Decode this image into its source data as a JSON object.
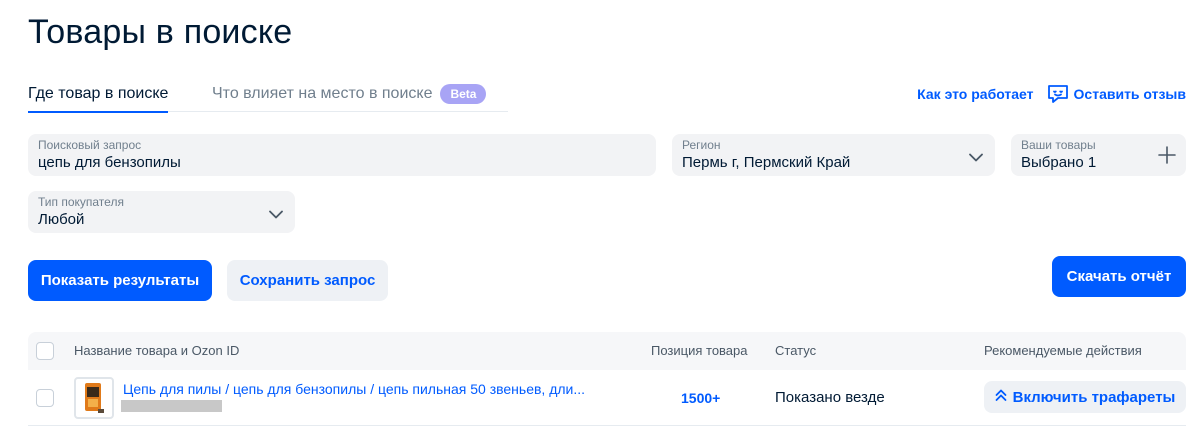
{
  "page": {
    "title": "Товары в поиске"
  },
  "tabs": [
    {
      "label": "Где товар в поиске",
      "active": true
    },
    {
      "label": "Что влияет на место в поиске",
      "badge": "Beta",
      "active": false
    }
  ],
  "top_links": {
    "how_it_works": "Как это работает",
    "feedback": "Оставить отзыв",
    "feedback_icon": "chat-feedback-icon"
  },
  "filters": {
    "query": {
      "label": "Поисковый запрос",
      "value": "цепь для бензопилы"
    },
    "region": {
      "label": "Регион",
      "value": "Пермь г, Пермский Край"
    },
    "goods": {
      "label": "Ваши товары",
      "value": "Выбрано 1"
    },
    "buyer_type": {
      "label": "Тип покупателя",
      "value": "Любой"
    }
  },
  "buttons": {
    "show_results": "Показать результаты",
    "save_query": "Сохранить запрос",
    "download_report": "Скачать отчёт"
  },
  "table": {
    "columns": [
      "Название товара и Ozon ID",
      "Позиция товара",
      "Статус",
      "Рекомендуемые действия"
    ],
    "rows": [
      {
        "name": "Цепь для пилы / цепь для бензопилы / цепь пильная 50 звеньев, дли...",
        "position": "1500+",
        "status": "Показано везде",
        "action": "Включить трафареты"
      }
    ]
  },
  "colors": {
    "accent": "#005bff",
    "beta_badge": "#a8a4f5",
    "field_bg": "#f2f3f5",
    "text_primary": "#001a34",
    "text_muted": "#707f8d"
  }
}
